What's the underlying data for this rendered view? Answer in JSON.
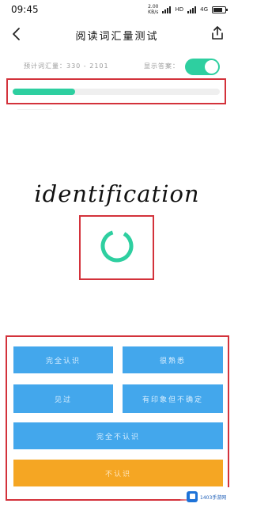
{
  "status_bar": {
    "time": "09:45",
    "net_speed_value": "2.00",
    "net_speed_unit": "KB/s",
    "network_label": "HD",
    "cell_label": "4G"
  },
  "header": {
    "title": "阅读词汇量测试",
    "back_icon": "chevron-left-icon",
    "share_icon": "share-icon"
  },
  "info": {
    "vocab_label": "预计词汇量：330 - 2101",
    "show_answer_label": "显示答案：",
    "show_answer_on": true
  },
  "progress": {
    "fraction": 0.3,
    "color": "#2ecfa0"
  },
  "word": "identification",
  "buttons": {
    "b1": "完全认识",
    "b2": "很熟悉",
    "b3": "见过",
    "b4": "有印象但不确定",
    "b5": "完全不认识",
    "b6": "不认识"
  },
  "colors": {
    "accent_green": "#2ecfa0",
    "button_blue": "#43a7ec",
    "button_orange": "#f5a623",
    "highlight_red": "#d3323b"
  },
  "watermark": {
    "text": "1403手游网"
  }
}
